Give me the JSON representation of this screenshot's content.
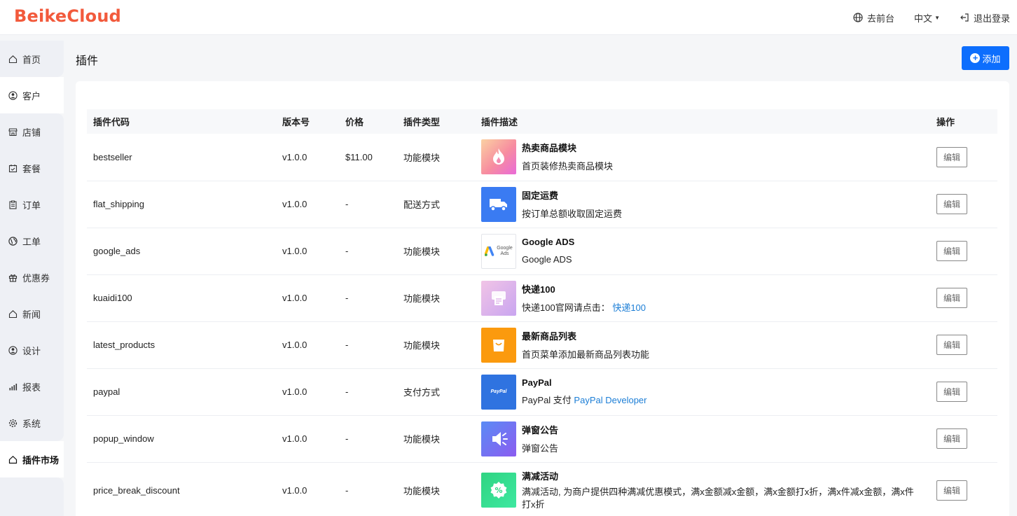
{
  "header": {
    "logo": "BeikeCloud",
    "frontend_label": "去前台",
    "language_label": "中文",
    "logout_label": "退出登录"
  },
  "sidebar": {
    "items": [
      {
        "label": "首页",
        "icon": "home-icon"
      },
      {
        "label": "客户",
        "icon": "user-circle-icon"
      },
      {
        "label": "店铺",
        "icon": "store-icon"
      },
      {
        "label": "套餐",
        "icon": "calendar-check-icon"
      },
      {
        "label": "订单",
        "icon": "clipboard-icon"
      },
      {
        "label": "工单",
        "icon": "globe-icon"
      },
      {
        "label": "优惠券",
        "icon": "gift-icon"
      },
      {
        "label": "新闻",
        "icon": "home-icon"
      },
      {
        "label": "设计",
        "icon": "user-circle-icon"
      },
      {
        "label": "报表",
        "icon": "bar-chart-icon"
      },
      {
        "label": "系统",
        "icon": "gear-icon"
      },
      {
        "label": "插件市场",
        "icon": "home-icon"
      }
    ]
  },
  "main": {
    "title": "插件",
    "add_label": "添加",
    "columns": [
      "插件代码",
      "版本号",
      "价格",
      "插件类型",
      "插件描述",
      "操作"
    ],
    "edit_label": "编辑",
    "rows": [
      {
        "code": "bestseller",
        "version": "v1.0.0",
        "price": "$11.00",
        "type": "功能模块",
        "title": "热卖商品模块",
        "desc": "首页装修热卖商品模块",
        "link": ""
      },
      {
        "code": "flat_shipping",
        "version": "v1.0.0",
        "price": "-",
        "type": "配送方式",
        "title": "固定运费",
        "desc": "按订单总额收取固定运费",
        "link": ""
      },
      {
        "code": "google_ads",
        "version": "v1.0.0",
        "price": "-",
        "type": "功能模块",
        "title": "Google ADS",
        "desc": "Google ADS",
        "link": ""
      },
      {
        "code": "kuaidi100",
        "version": "v1.0.0",
        "price": "-",
        "type": "功能模块",
        "title": "快递100",
        "desc": "快递100官网请点击： ",
        "link": "快递100"
      },
      {
        "code": "latest_products",
        "version": "v1.0.0",
        "price": "-",
        "type": "功能模块",
        "title": "最新商品列表",
        "desc": "首页菜单添加最新商品列表功能",
        "link": ""
      },
      {
        "code": "paypal",
        "version": "v1.0.0",
        "price": "-",
        "type": "支付方式",
        "title": "PayPal",
        "desc": "PayPal 支付 ",
        "link": "PayPal Developer"
      },
      {
        "code": "popup_window",
        "version": "v1.0.0",
        "price": "-",
        "type": "功能模块",
        "title": "弹窗公告",
        "desc": "弹窗公告",
        "link": ""
      },
      {
        "code": "price_break_discount",
        "version": "v1.0.0",
        "price": "-",
        "type": "功能模块",
        "title": "满减活动",
        "desc": "满减活动, 为商户提供四种满减优惠模式，满x金额减x金额，满x金额打x折，满x件减x金额，满x件打x折",
        "link": ""
      }
    ],
    "thumbnails": {
      "google_ads_text": "Google",
      "google_ads_sub": "Ads",
      "paypal_text": "PayPal"
    }
  },
  "colors": {
    "brand": "#f25a3c",
    "primary": "#0d6efd",
    "link": "#1c7ed6"
  }
}
